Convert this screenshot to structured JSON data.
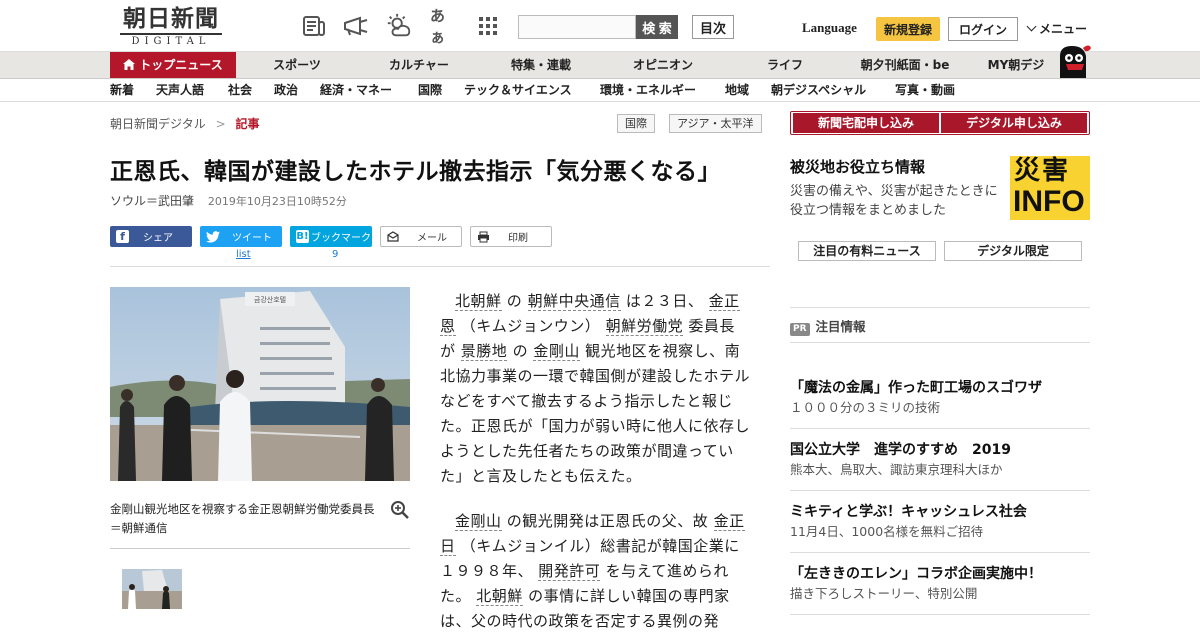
{
  "header": {
    "logo_main": "朝日新聞",
    "logo_sub": "DIGITAL",
    "icons": [
      "newspaper-icon",
      "megaphone-icon",
      "weather-icon",
      "font-size-icon",
      "grid-icon"
    ],
    "font_icon_text": "あぁ",
    "search_placeholder": "",
    "search_button": "検 索",
    "contents_button": "目次",
    "language": "Language",
    "register": "新規登録",
    "login": "ログイン",
    "menu": "メニュー"
  },
  "nav_main": {
    "top": "トップニュース",
    "items": [
      "スポーツ",
      "カルチャー",
      "特集・連載",
      "オピニオン",
      "ライフ",
      "朝夕刊紙面・be",
      "MY朝デジ"
    ]
  },
  "nav_sub": {
    "items": [
      "新着",
      "天声人語",
      "社会",
      "政治",
      "経済・マネー",
      "国際",
      "テック＆サイエンス",
      "環境・エネルギー",
      "地域",
      "朝デジスペシャル",
      "写真・動画"
    ]
  },
  "breadcrumb": {
    "home": "朝日新聞デジタル",
    "sep": ">",
    "current": "記事"
  },
  "tags": [
    "国際",
    "アジア・太平洋"
  ],
  "subscribe": {
    "paper": "新聞宅配申し込み",
    "digital": "デジタル申し込み"
  },
  "article": {
    "title": "正恩氏、韓国が建設したホテル撤去指示「気分悪くなる」",
    "author": "ソウル＝武田肇",
    "date": "2019年10月23日10時52分",
    "share": {
      "facebook": "シェア",
      "twitter": "ツイート",
      "hatena": "ブックマーク",
      "mail": "メール",
      "print": "印刷",
      "twitter_count": "list",
      "hatena_count": "9"
    },
    "caption": "金剛山観光地区を視察する金正恩朝鮮労働党委員長＝朝鮮通信",
    "photo_sign": "금강산호텔",
    "p1": {
      "a": "北朝鮮",
      "b": " の ",
      "c": "朝鮮中央通信",
      "d": " は２３日、 ",
      "e": "金正恩",
      "f": " （キムジョンウン） ",
      "g": "朝鮮労働党",
      "h": " 委員長が ",
      "i": "景勝地",
      "j": " の ",
      "k": "金剛山",
      "l": " 観光地区を視察し、南北協力事業の一環で韓国側が建設したホテルなどをすべて撤去するよう指示したと報じた。正恩氏が「国力が弱い時に他人に依存しようとした先任者たちの政策が間違っていた」と言及したとも伝えた。"
    },
    "p2": {
      "a": "金剛山",
      "b": " の観光開発は正恩氏の父、故 ",
      "c": "金正日",
      "d": " （キムジョンイル）総書記が韓国企業に１９９８年、 ",
      "e": "開発許可",
      "f": " を与えて進められた。 ",
      "g": "北朝鮮",
      "h": " の事情に詳しい韓国の専門家は、父の時代の政策を否定する異例の発"
    }
  },
  "sidebar": {
    "disaster_title": "被災地お役立ち情報",
    "disaster_desc": "災害の備えや、災害が起きたときに役立つ情報をまとめました",
    "disaster_logo_top": "災害",
    "disaster_logo_bottom": "INFO",
    "btn_paid": "注目の有料ニュース",
    "btn_digital": "デジタル限定",
    "pr_badge": "PR",
    "pr_label": "注目情報",
    "pr_items": [
      {
        "title": "「魔法の金属」作った町工場のスゴワザ",
        "sub": "１０００分の３ミリの技術"
      },
      {
        "title": "国公立大学　進学のすすめ　2019",
        "sub": "熊本大、鳥取大、諏訪東京理科大ほか"
      },
      {
        "title": "ミキティと学ぶ！キャッシュレス社会",
        "sub": "11月4日、1000名様を無料ご招待"
      },
      {
        "title": "「左ききのエレン」コラボ企画実施中！",
        "sub": "描き下ろしストーリー、特別公開"
      }
    ]
  },
  "colors": {
    "brand_red": "#b5172a",
    "register_yellow": "#f5c542",
    "facebook": "#3b5998",
    "twitter": "#1da1f2",
    "hatena": "#00a4de",
    "disaster_yellow": "#f7d230"
  }
}
